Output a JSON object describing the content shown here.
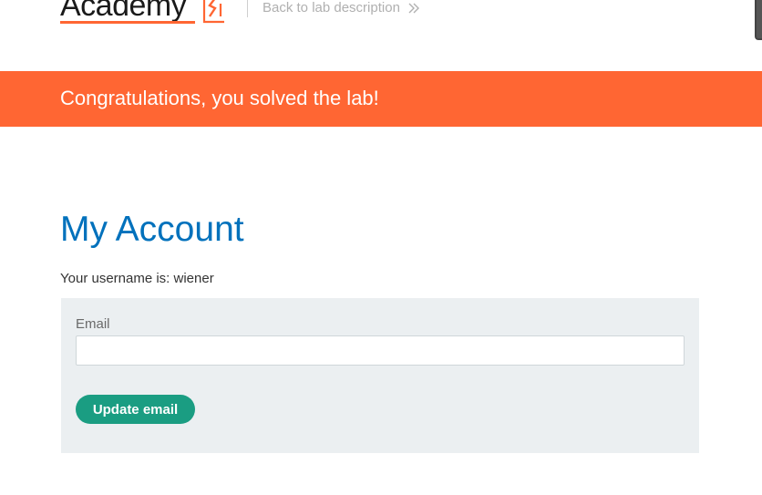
{
  "header": {
    "logo_text": "Academy",
    "back_link_label": "Back to lab description",
    "brand_color": "#ff6633"
  },
  "banner": {
    "message": "Congratulations, you solved the lab!",
    "background": "#ff6633"
  },
  "main": {
    "title": "My Account",
    "username_line": "Your username is: wiener"
  },
  "form": {
    "email_label": "Email",
    "email_value": "",
    "email_placeholder": "",
    "submit_label": "Update email",
    "button_color": "#1a9d82"
  },
  "icons": {
    "logo_mark": "bolt-icon",
    "back_arrow": "double-chevron-right-icon"
  }
}
